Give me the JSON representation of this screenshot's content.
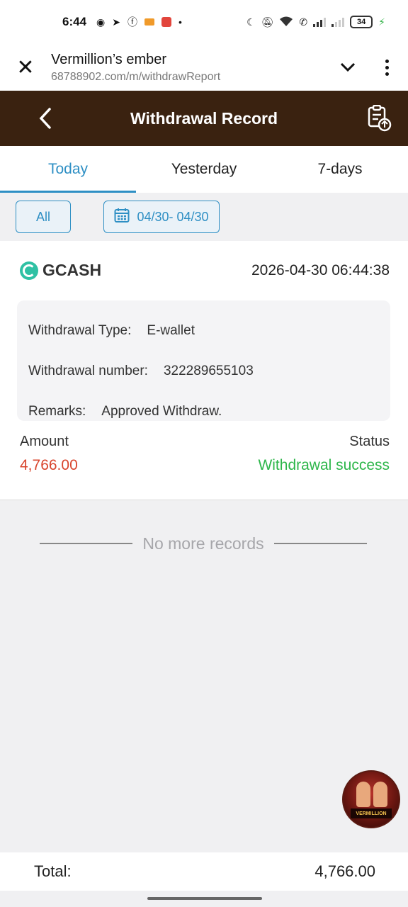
{
  "status_bar": {
    "time": "6:44",
    "battery": "34",
    "colors": {
      "charging": "#35b34a"
    }
  },
  "browser": {
    "title": "Vermillion’s ember",
    "url": "68788902.com/m/withdrawReport"
  },
  "header": {
    "title": "Withdrawal Record",
    "colors": {
      "background": "#3a2210"
    }
  },
  "tabs": [
    {
      "label": "Today",
      "active": true
    },
    {
      "label": "Yesterday",
      "active": false
    },
    {
      "label": "7-days",
      "active": false
    }
  ],
  "filters": {
    "all_label": "All",
    "date_range": "04/30- 04/30"
  },
  "record": {
    "method": "GCASH",
    "datetime": "2026-04-30 06:44:38",
    "details": [
      {
        "label": "Withdrawal Type:",
        "value": "E-wallet"
      },
      {
        "label": "Withdrawal number:",
        "value": "322289655103"
      },
      {
        "label": "Remarks:",
        "value": "Approved Withdraw."
      }
    ],
    "amount_label": "Amount",
    "amount": "4,766.00",
    "status_label": "Status",
    "status": "Withdrawal success",
    "colors": {
      "amount": "#d8452d",
      "status": "#2db64a"
    }
  },
  "list_end_text": "No more records",
  "support": {
    "badge_text": "VERMILLION"
  },
  "footer": {
    "total_label": "Total:",
    "total_value": "4,766.00"
  },
  "accent_color": "#2e8fc4"
}
